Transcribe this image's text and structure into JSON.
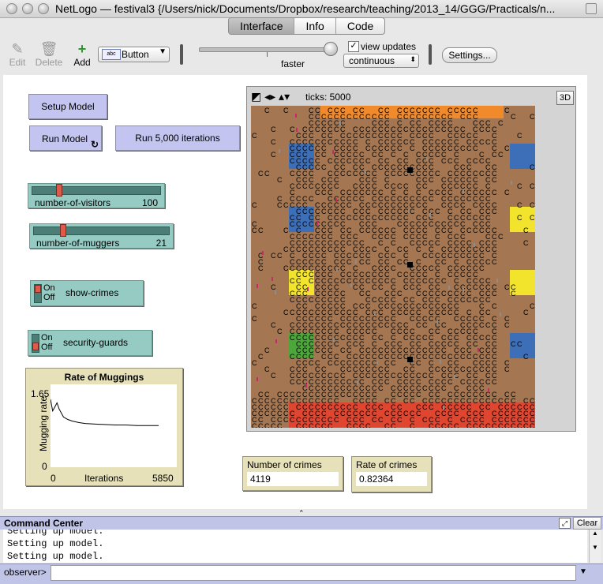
{
  "window": {
    "title": "NetLogo — festival3 {/Users/nick/Documents/Dropbox/research/teaching/2013_14/GGG/Practicals/n..."
  },
  "tabs": [
    {
      "label": "Interface",
      "active": true
    },
    {
      "label": "Info",
      "active": false
    },
    {
      "label": "Code",
      "active": false
    }
  ],
  "toolbar": {
    "edit_label": "Edit",
    "delete_label": "Delete",
    "add_label": "Add",
    "widget_type": "Button",
    "speed_label": "faster",
    "view_updates_label": "view updates",
    "view_updates_checked": true,
    "update_mode": "continuous",
    "settings_label": "Settings..."
  },
  "interface": {
    "buttons": {
      "setup": "Setup Model",
      "run": "Run Model",
      "run5000": "Run 5,000 iterations"
    },
    "sliders": [
      {
        "name": "number-of-visitors",
        "value": "100",
        "fraction": 0.17
      },
      {
        "name": "number-of-muggers",
        "value": "21",
        "fraction": 0.21
      }
    ],
    "switches": [
      {
        "name": "show-crimes",
        "on_label": "On",
        "off_label": "Off",
        "state": "on"
      },
      {
        "name": "security-guards",
        "on_label": "On",
        "off_label": "Off",
        "state": "off"
      }
    ],
    "plot": {
      "title": "Rate of Muggings",
      "ylabel": "Mugging rate",
      "xlabel": "Iterations",
      "ymax_label": "1.65",
      "ymin_label": "0",
      "xmin_label": "0",
      "xmax_label": "5850"
    },
    "view": {
      "ticks_label": "ticks: 5000",
      "btn_3d": "3D",
      "cell_glyph": "C"
    },
    "monitors": [
      {
        "name": "Number of crimes",
        "value": "4119"
      },
      {
        "name": "Rate of crimes",
        "value": "0.82364"
      }
    ]
  },
  "chart_data": {
    "type": "line",
    "title": "Rate of Muggings",
    "xlabel": "Iterations",
    "ylabel": "Mugging rate",
    "xlim": [
      0,
      5850
    ],
    "ylim": [
      0,
      1.65
    ],
    "series": [
      {
        "x": [
          0,
          100,
          200,
          300,
          400,
          600,
          800,
          1000,
          1300,
          1600,
          2000,
          2500,
          3000,
          3500,
          4000,
          4500,
          5000
        ],
        "values": [
          1.35,
          1.12,
          1.2,
          1.28,
          1.16,
          1.0,
          0.95,
          0.92,
          0.89,
          0.87,
          0.86,
          0.85,
          0.84,
          0.84,
          0.83,
          0.83,
          0.83
        ]
      }
    ],
    "colors": {
      "line": "#000000"
    }
  },
  "world_colors": {
    "background": "#a47752",
    "orange": "#f08a2a",
    "blue": "#3d6fb8",
    "yellow": "#f2e42c",
    "green": "#4da63a",
    "red": "#e0452f",
    "pink": "#c42a6c",
    "grey": "#8d8d8d"
  },
  "command_center": {
    "title": "Command Center",
    "clear_label": "Clear",
    "output_lines": [
      "Setting up model.",
      "Setting up model.",
      "Setting up model."
    ],
    "prompt": "observer>"
  }
}
